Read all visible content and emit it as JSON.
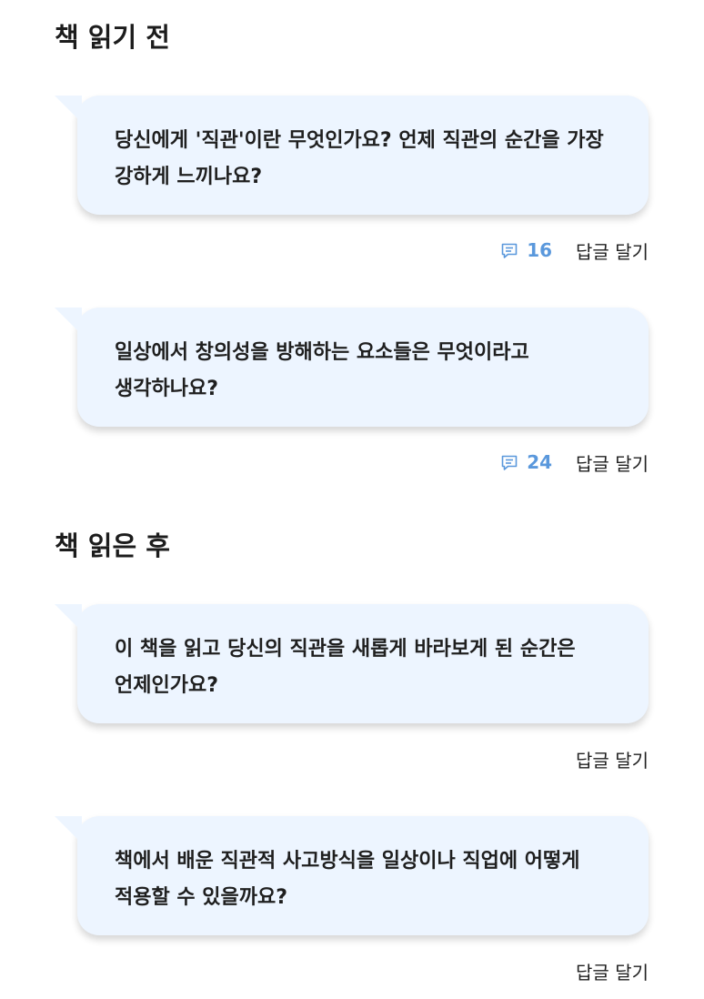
{
  "sections": [
    {
      "title": "책 읽기 전",
      "questions": [
        {
          "text": "당신에게 '직관'이란 무엇인가요? 언제 직관의 순간을 가장 강하게 느끼나요?",
          "reply_count": "16",
          "reply_label": "답글 달기"
        },
        {
          "text": "일상에서 창의성을 방해하는 요소들은 무엇이라고 생각하나요?",
          "reply_count": "24",
          "reply_label": "답글 달기"
        }
      ]
    },
    {
      "title": "책 읽은 후",
      "questions": [
        {
          "text": "이 책을 읽고 당신의 직관을 새롭게 바라보게 된 순간은 언제인가요?",
          "reply_label": "답글 달기"
        },
        {
          "text": "책에서 배운 직관적 사고방식을 일상이나 직업에 어떻게 적용할 수 있을까요?",
          "reply_label": "답글 달기"
        }
      ]
    }
  ],
  "colors": {
    "bubble_background": "#edf5ff",
    "accent": "#5a98dc",
    "text": "#1f1f1f"
  },
  "icons": {
    "reply_count": "comment-icon"
  }
}
